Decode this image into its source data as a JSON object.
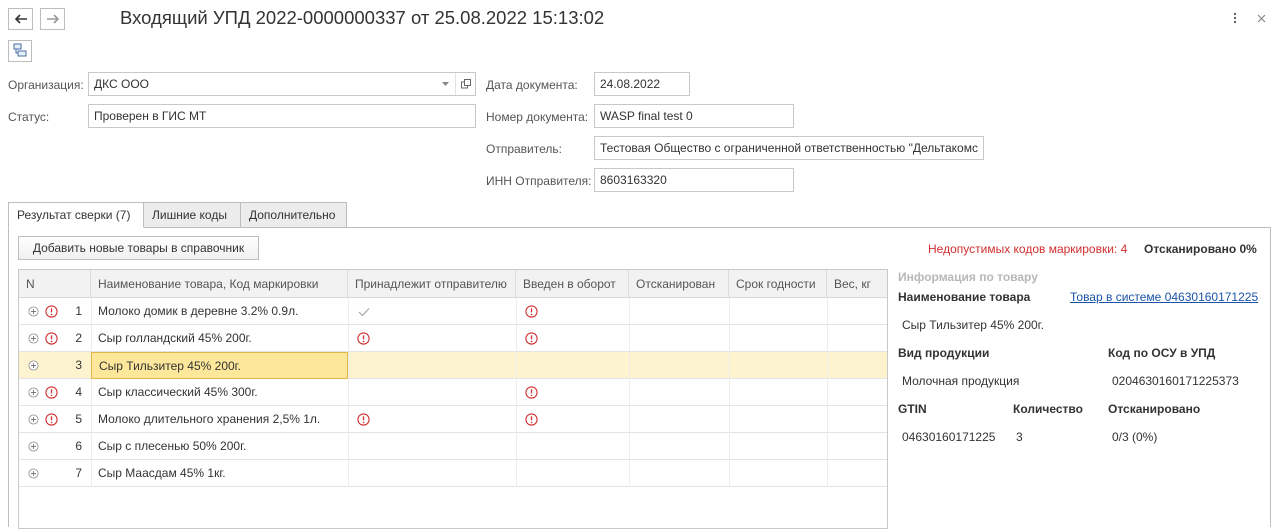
{
  "window": {
    "title": "Входящий УПД 2022-0000000337 от 25.08.2022 15:13:02"
  },
  "icons": {
    "back": "arrow-left-icon",
    "forward": "arrow-right-icon",
    "more": "kebab-icon",
    "close": "close-icon",
    "structure": "document-structure-icon",
    "open": "open-form-icon",
    "expand": "expand-plus-icon",
    "warning": "warning-circle-icon",
    "check": "check-icon"
  },
  "colors": {
    "warning_red": "#d32f2f",
    "selected_row": "#fdf4cf",
    "selected_cell": "#fde79a",
    "link": "#1a53a8"
  },
  "header": {
    "org_label": "Организация:",
    "org_value": "ДКС ООО",
    "status_label": "Статус:",
    "status_value": "Проверен в ГИС МТ",
    "date_label": "Дата документа:",
    "date_value": "24.08.2022",
    "number_label": "Номер документа:",
    "number_value": "WASP final test 0",
    "sender_label": "Отправитель:",
    "sender_value": "Тестовая Общество с ограниченной ответственностью \"Дельтакомс",
    "inn_label": "ИНН Отправителя:",
    "inn_value": "8603163320"
  },
  "tabs": [
    {
      "label": "Результат сверки (7)",
      "active": true
    },
    {
      "label": "Лишние коды",
      "active": false
    },
    {
      "label": "Дополнительно",
      "active": false
    }
  ],
  "toolbar": {
    "add_button": "Добавить новые товары в справочник",
    "invalid_codes": "Недопустимых кодов маркировки: 4",
    "scanned": "Отсканировано 0%"
  },
  "table": {
    "columns": [
      "N",
      "Наименование товара, Код маркировки",
      "Принадлежит отправителю",
      "Введен в оборот",
      "Отсканирован",
      "Срок годности",
      "Вес, кг"
    ],
    "rows": [
      {
        "n": "1",
        "name": "Молоко домик в деревне 3.2% 0.9л.",
        "warn": true,
        "sender": "check",
        "turnover": "warn",
        "selected": false
      },
      {
        "n": "2",
        "name": "Сыр голландский 45% 200г.",
        "warn": true,
        "sender": "warn",
        "turnover": "warn",
        "selected": false
      },
      {
        "n": "3",
        "name": "Сыр Тильзитер 45% 200г.",
        "warn": false,
        "sender": "",
        "turnover": "",
        "selected": true
      },
      {
        "n": "4",
        "name": "Сыр классический 45% 300г.",
        "warn": true,
        "sender": "",
        "turnover": "warn",
        "selected": false
      },
      {
        "n": "5",
        "name": "Молоко длительного хранения 2,5% 1л.",
        "warn": true,
        "sender": "warn",
        "turnover": "warn",
        "selected": false
      },
      {
        "n": "6",
        "name": "Сыр с плесенью 50% 200г.",
        "warn": false,
        "sender": "",
        "turnover": "",
        "selected": false
      },
      {
        "n": "7",
        "name": "Сыр Маасдам 45% 1кг.",
        "warn": false,
        "sender": "",
        "turnover": "",
        "selected": false
      }
    ]
  },
  "info": {
    "heading": "Информация по товару",
    "product_name_label": "Наименование товара",
    "system_link": "Товар в системе 04630160171225",
    "product_name": "Сыр Тильзитер 45% 200г.",
    "product_type_label": "Вид продукции",
    "osu_label": "Код по ОСУ в УПД",
    "product_type": "Молочная продукция",
    "osu_code": "0204630160171225373",
    "gtin_label": "GTIN",
    "qty_label": "Количество",
    "scanned_label": "Отсканировано",
    "gtin": "04630160171225",
    "qty": "3",
    "scanned": "0/3 (0%)"
  }
}
